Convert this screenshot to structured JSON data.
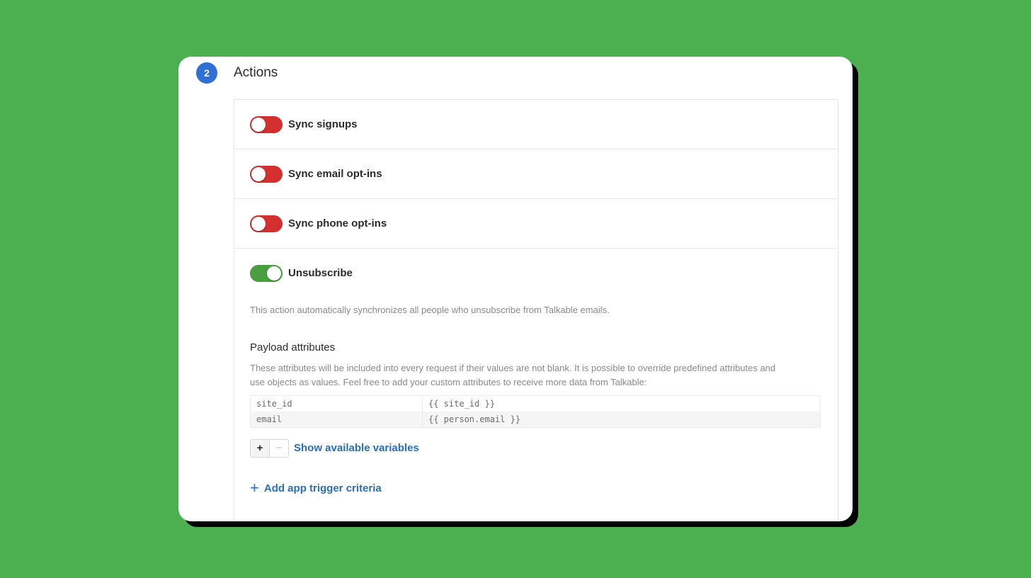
{
  "section": {
    "step_number": "2",
    "title": "Actions"
  },
  "actions": [
    {
      "label": "Sync signups",
      "enabled": false
    },
    {
      "label": "Sync email opt-ins",
      "enabled": false
    },
    {
      "label": "Sync phone opt-ins",
      "enabled": false
    },
    {
      "label": "Unsubscribe",
      "enabled": true
    }
  ],
  "unsubscribe": {
    "description": "This action automatically synchronizes all people who unsubscribe from Talkable emails.",
    "payload_title": "Payload attributes",
    "payload_description": "These attributes will be included into every request if their values are not blank. It is possible to override predefined attributes and use objects as values. Feel free to add your custom attributes to receive more data from Talkable:",
    "attributes": [
      {
        "key": "site_id",
        "value": "{{ site_id }}"
      },
      {
        "key": "email",
        "value": "{{ person.email }}"
      }
    ],
    "add_button": "+",
    "remove_button": "−",
    "show_variables_link": "Show available variables",
    "add_trigger_icon": "+",
    "add_trigger_link": "Add app trigger criteria"
  },
  "colors": {
    "background": "#4caf50",
    "toggle_off": "#d32f2f",
    "toggle_on": "#4a9e3f",
    "link": "#2a6ebb",
    "step_badge": "#2f6fd6"
  }
}
